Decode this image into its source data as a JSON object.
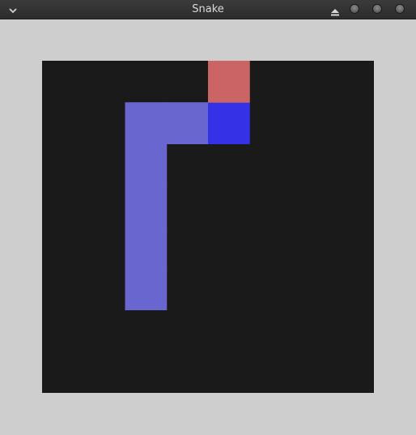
{
  "window": {
    "title": "Snake",
    "menu_icon": "chevron-down-icon",
    "controls": [
      "eject-icon",
      "minimize-icon",
      "maximize-icon",
      "close-icon"
    ]
  },
  "colors": {
    "window_bg": "#cecece",
    "board_bg": "#1a1a1a",
    "snake_body": "#6a66cf",
    "snake_head": "#3531e6",
    "food": "#cb6465"
  },
  "game": {
    "grid_cols": 8,
    "grid_rows": 8,
    "food": {
      "col": 4,
      "row": 0
    },
    "snake_head": {
      "col": 4,
      "row": 1
    },
    "snake_body": [
      {
        "col": 3,
        "row": 1
      },
      {
        "col": 2,
        "row": 1
      },
      {
        "col": 2,
        "row": 2
      },
      {
        "col": 2,
        "row": 3
      },
      {
        "col": 2,
        "row": 4
      },
      {
        "col": 2,
        "row": 5
      }
    ]
  }
}
